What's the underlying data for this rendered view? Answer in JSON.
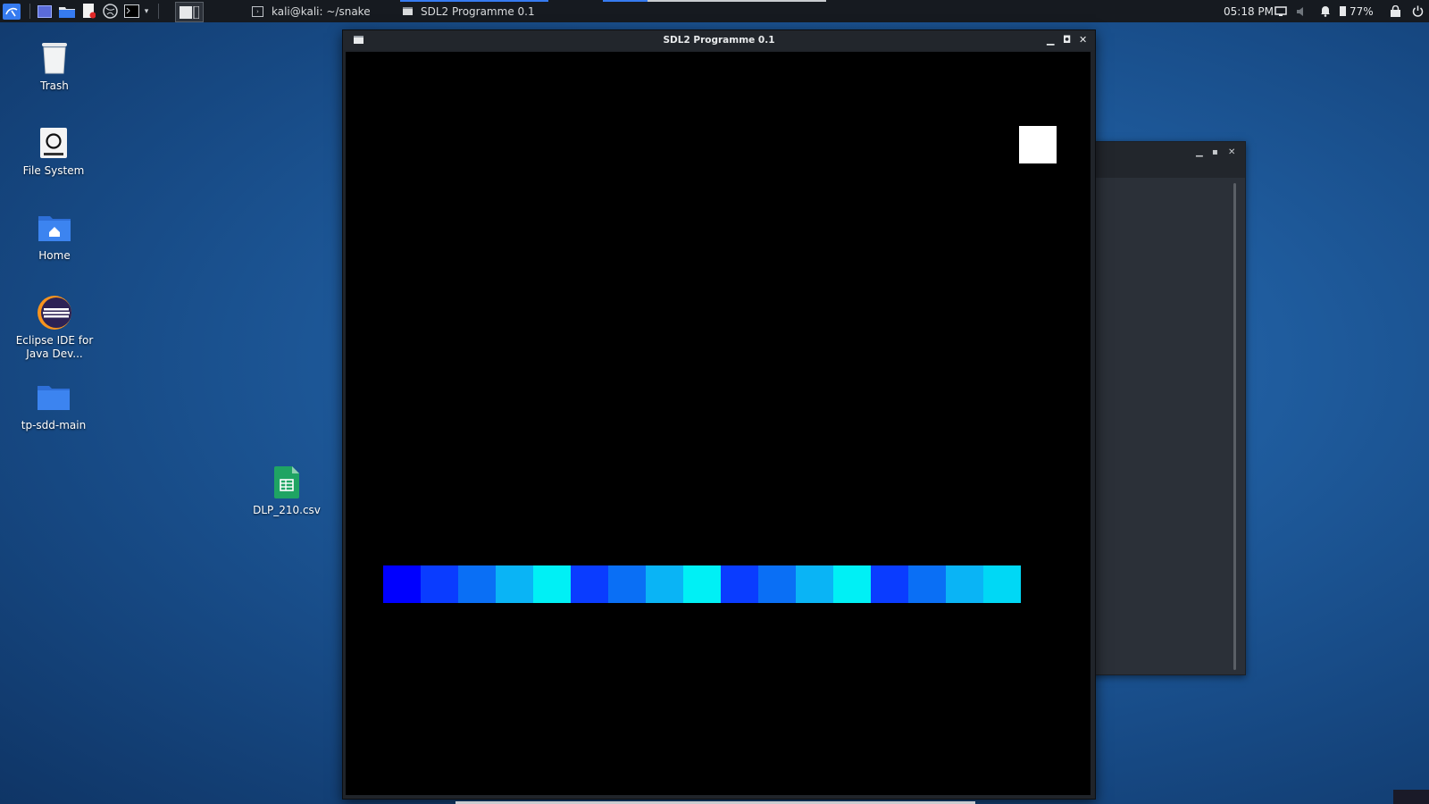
{
  "panel": {
    "tasks": [
      {
        "label": "kali@kali: ~/snake",
        "active": false
      },
      {
        "label": "SDL2 Programme 0.1",
        "active": true
      }
    ],
    "clock": "05:18 PM",
    "battery": "77%"
  },
  "desktop_icons": [
    {
      "label": "Trash",
      "icon": "trash-icon"
    },
    {
      "label": "File System",
      "icon": "drive-icon"
    },
    {
      "label": "Home",
      "icon": "home-folder-icon"
    },
    {
      "label": "Eclipse IDE for Java Dev...",
      "icon": "eclipse-icon"
    },
    {
      "label": "tp-sdd-main",
      "icon": "folder-icon"
    },
    {
      "label": "DLP_210.csv",
      "icon": "spreadsheet-icon"
    }
  ],
  "main_window": {
    "title": "SDL2 Programme 0.1"
  },
  "game": {
    "food_color": "#ffffff",
    "snake_colors": [
      "#0000ff",
      "#0a3cff",
      "#0a6ff5",
      "#0ab4f5",
      "#00f0f5",
      "#0a3cff",
      "#0a6ff5",
      "#0ab4f5",
      "#00f0f5",
      "#0a3cff",
      "#0a6ff5",
      "#0ab4f5",
      "#00f0f5",
      "#0a3cff",
      "#0a6ff5",
      "#0ab4f5",
      "#00d8f5"
    ]
  },
  "colors": {
    "accent": "#367bf0",
    "panel_bg": "#161a20",
    "canvas_bg": "#000000"
  }
}
